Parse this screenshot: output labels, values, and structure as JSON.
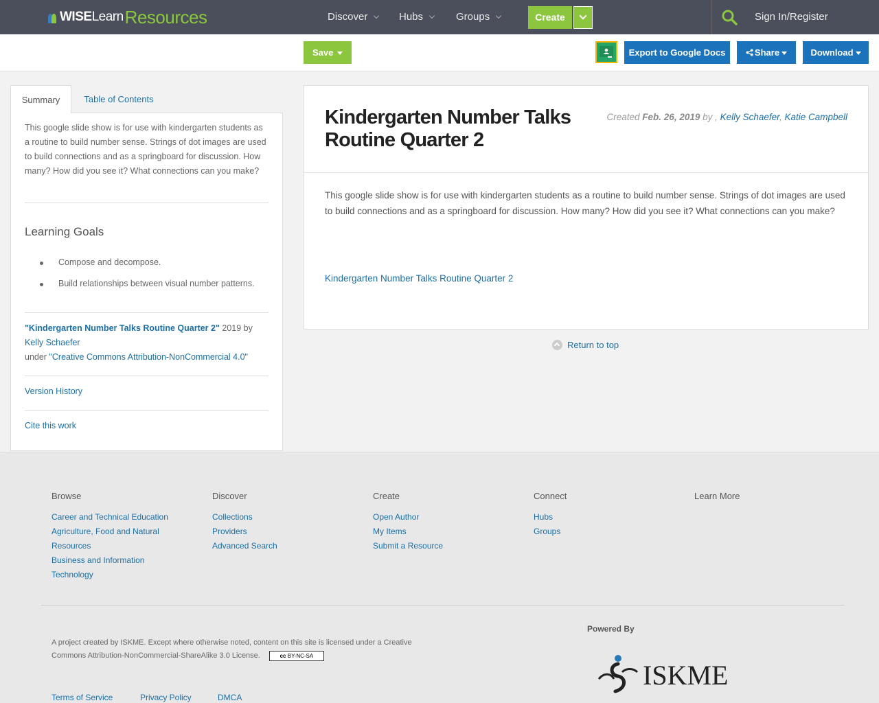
{
  "header": {
    "logo": {
      "wise": "WISE",
      "learn": "Learn",
      "resources": "Resources"
    },
    "nav": [
      "Discover",
      "Hubs",
      "Groups"
    ],
    "create_label": "Create",
    "signin_label": "Sign In/Register",
    "colors": {
      "bar": "#4a4f5b",
      "green": "#8cc63f"
    }
  },
  "toolbar": {
    "save_label": "Save",
    "export_label": "Export to Google Docs",
    "share_label": "Share",
    "download_label": "Download",
    "colors": {
      "blue": "#1a73bb"
    }
  },
  "sidebar": {
    "tabs": [
      "Summary",
      "Table of Contents"
    ],
    "description": "This google slide show is for use with kindergarten students as a routine to build number sense. Strings of dot images are used to build connections and as a springboard for discussion. How many? How did you see it? What connections can you make?",
    "goals_title": "Learning Goals",
    "goals": [
      "Compose and decompose.",
      "Build relationships between visual number patterns."
    ],
    "attribution": {
      "title": "\"Kindergarten Number Talks Routine Quarter 2\"",
      "year_by": " 2019 by",
      "author": "Kelly Schaefer",
      "under": "under ",
      "license": "\"Creative Commons Attribution-NonCommercial 4.0\""
    },
    "version_history": "Version History",
    "cite": "Cite this work"
  },
  "main": {
    "title": "Kindergarten Number Talks Routine Quarter 2",
    "created_label": "Created ",
    "created_date": "Feb. 26, 2019",
    "by_label": " by , ",
    "authors": [
      "Kelly Schaefer",
      "Katie Campbell"
    ],
    "description": "This google slide show is for use with kindergarten students as a routine to build number sense. Strings of dot images are used to build connections and as a springboard for discussion. How many? How did you see it? What connections can you make?",
    "link": "Kindergarten Number Talks Routine Quarter 2",
    "return_top": "Return to top"
  },
  "footer": {
    "columns": [
      {
        "title": "Browse",
        "links": [
          "Career and Technical Education",
          "Agriculture, Food and Natural Resources",
          "Business and Information Technology"
        ]
      },
      {
        "title": "Discover",
        "links": [
          "Collections",
          "Providers",
          "Advanced Search"
        ]
      },
      {
        "title": "Create",
        "links": [
          "Open Author",
          "My Items",
          "Submit a Resource"
        ]
      },
      {
        "title": "Connect",
        "links": [
          "Hubs",
          "Groups"
        ]
      },
      {
        "title": "Learn More",
        "links": []
      }
    ],
    "license_text": "A project created by ISKME. Except where otherwise noted, content on this site is licensed under a Creative Commons Attribution-NonCommercial-ShareAlike 3.0 License.",
    "cc_badge": "BY-NC-SA",
    "powered_by": "Powered By",
    "iskme_logo": "ISKME",
    "bottom_links": [
      "Terms of Service",
      "Privacy Policy",
      "DMCA"
    ]
  }
}
